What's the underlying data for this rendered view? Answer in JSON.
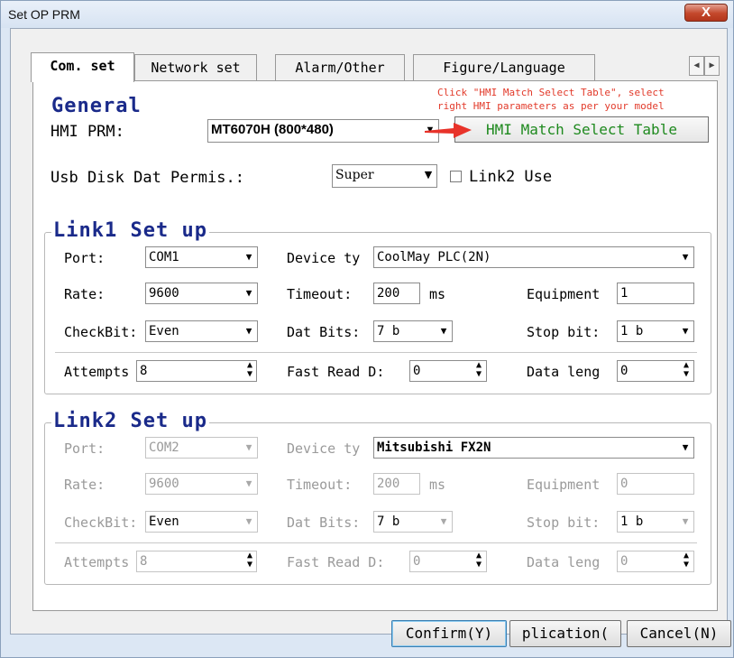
{
  "window": {
    "title": "Set OP PRM",
    "close_label": "X"
  },
  "tabs": [
    {
      "label": "Com. set",
      "selected": true
    },
    {
      "label": "Network set",
      "selected": false
    },
    {
      "label": "Alarm/Other",
      "selected": false
    },
    {
      "label": "Figure/Language",
      "selected": false
    }
  ],
  "tab_scroll": {
    "left": "◀",
    "right": "▶"
  },
  "general": {
    "title": "General",
    "hmi_prm_label": "HMI PRM:",
    "hmi_prm_value": "MT6070H (800*480)",
    "note": "Click \"HMI Match Select Table\", select right HMI parameters as per your model",
    "note_line1": "Click \"HMI Match Select Table\", select",
    "note_line2": "right HMI parameters as per your model",
    "match_button": "HMI Match Select Table",
    "usb_label": "Usb Disk Dat Permis.:",
    "usb_value": "Super",
    "link2_use_label": "Link2 Use",
    "link2_use_checked": false
  },
  "link1": {
    "title": "Link1 Set up",
    "port_label": "Port:",
    "port_value": "COM1",
    "device_label": "Device ty",
    "device_value": "CoolMay PLC(2N)",
    "rate_label": "Rate:",
    "rate_value": "9600",
    "timeout_label": "Timeout:",
    "timeout_value": "200",
    "timeout_unit": "ms",
    "equipment_label": "Equipment",
    "equipment_value": "1",
    "checkbit_label": "CheckBit:",
    "checkbit_value": "Even",
    "datbits_label": "Dat Bits:",
    "datbits_value": "7 b",
    "stopbit_label": "Stop bit:",
    "stopbit_value": "1 b",
    "attempts_label": "Attempts",
    "attempts_value": "8",
    "fastread_label": "Fast Read D:",
    "fastread_value": "0",
    "datalen_label": "Data leng",
    "datalen_value": "0"
  },
  "link2": {
    "title": "Link2 Set up",
    "port_label": "Port:",
    "port_value": "COM2",
    "device_label": "Device ty",
    "device_value": "Mitsubishi FX2N",
    "rate_label": "Rate:",
    "rate_value": "9600",
    "timeout_label": "Timeout:",
    "timeout_value": "200",
    "timeout_unit": "ms",
    "equipment_label": "Equipment",
    "equipment_value": "0",
    "checkbit_label": "CheckBit:",
    "checkbit_value": "Even",
    "datbits_label": "Dat Bits:",
    "datbits_value": "7 b",
    "stopbit_label": "Stop bit:",
    "stopbit_value": "1 b",
    "attempts_label": "Attempts",
    "attempts_value": "8",
    "fastread_label": "Fast Read D:",
    "fastread_value": "0",
    "datalen_label": "Data leng",
    "datalen_value": "0"
  },
  "buttons": {
    "confirm": "Confirm(Y)",
    "apply": "plication(",
    "cancel": "Cancel(N)"
  },
  "colors": {
    "group_title": "#1a2a8a",
    "note": "#e23a2a",
    "match_text": "#1f8a1f",
    "arrow": "#e8332a"
  }
}
